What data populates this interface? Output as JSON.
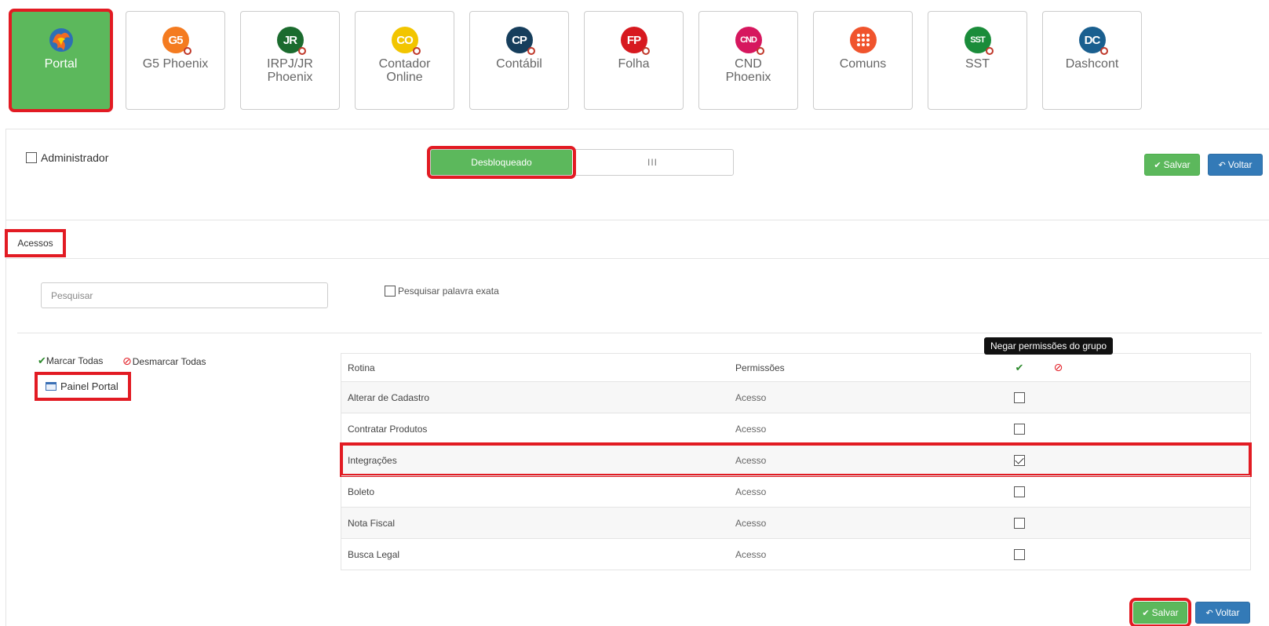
{
  "modules": [
    {
      "label": "Portal",
      "abbr": "",
      "color": "#e6552b"
    },
    {
      "label": "G5 Phoenix",
      "abbr": "G5",
      "color": "#f47b20"
    },
    {
      "label": "IRPJ/JR Phoenix",
      "abbr": "JR",
      "color": "#1b6b2e"
    },
    {
      "label": "Contador Online",
      "abbr": "CO",
      "color": "#f2c500"
    },
    {
      "label": "Contábil",
      "abbr": "CP",
      "color": "#163e5c"
    },
    {
      "label": "Folha",
      "abbr": "FP",
      "color": "#d7191f"
    },
    {
      "label": "CND Phoenix",
      "abbr": "CND",
      "color": "#d6175e"
    },
    {
      "label": "Comuns",
      "abbr": "",
      "color": "#f0542d"
    },
    {
      "label": "SST",
      "abbr": "SST",
      "color": "#1a8c3a"
    },
    {
      "label": "Dashcont",
      "abbr": "DC",
      "color": "#1a5f8f"
    }
  ],
  "admin_label": "Administrador",
  "toggle": {
    "on_label": "Desbloqueado",
    "off_label": "III"
  },
  "buttons": {
    "save": "Salvar",
    "back": "Voltar"
  },
  "tab_label": "Acessos",
  "search": {
    "placeholder": "Pesquisar",
    "exact_label": "Pesquisar palavra exata"
  },
  "mark_all": "Marcar Todas",
  "unmark_all": "Desmarcar Todas",
  "tree_node": "Painel Portal",
  "table": {
    "headers": {
      "routine": "Rotina",
      "permissions": "Permissões"
    },
    "tooltip": "Negar permissões do grupo",
    "rows": [
      {
        "routine": "Alterar de Cadastro",
        "permission": "Acesso",
        "checked": false
      },
      {
        "routine": "Contratar Produtos",
        "permission": "Acesso",
        "checked": false
      },
      {
        "routine": "Integrações",
        "permission": "Acesso",
        "checked": true
      },
      {
        "routine": "Boleto",
        "permission": "Acesso",
        "checked": false
      },
      {
        "routine": "Nota Fiscal",
        "permission": "Acesso",
        "checked": false
      },
      {
        "routine": "Busca Legal",
        "permission": "Acesso",
        "checked": false
      }
    ]
  }
}
